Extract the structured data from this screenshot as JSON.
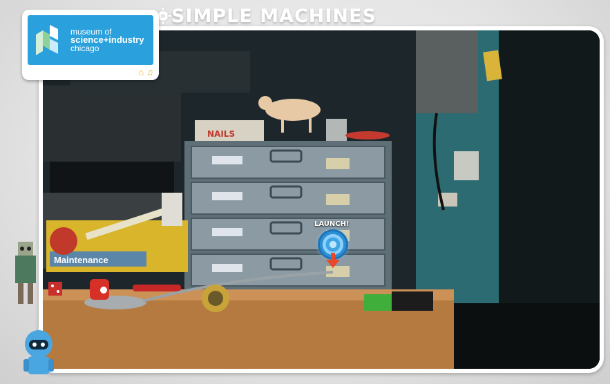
{
  "header": {
    "title": "SIMPLE MACHINES"
  },
  "logo": {
    "line1": "museum of",
    "line2": "science+industry",
    "line3": "chicago",
    "home_icon": "home-icon",
    "music_icon": "music-note-icon",
    "home_glyph": "⌂",
    "music_glyph": "♫"
  },
  "scene": {
    "launch_label": "LAUNCH!",
    "box_label": "Maintenance",
    "nails_label": "NAILS"
  },
  "colors": {
    "logo_blue": "#2aa0dc",
    "logo_icon_yellow": "#f2b21b",
    "launch_blue": "#3fa6e6",
    "arrow_red": "#e8492a",
    "bench_wood": "#b57a40",
    "drawer_gray": "#7b8a94"
  }
}
